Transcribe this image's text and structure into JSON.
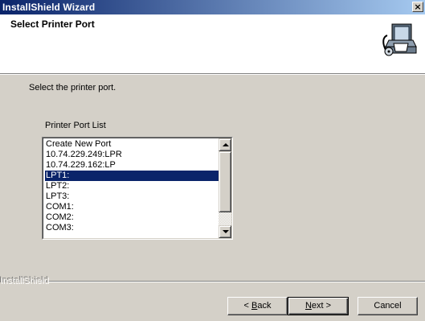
{
  "window": {
    "title": "InstallShield Wizard",
    "close_glyph": "×"
  },
  "header": {
    "title": "Select Printer Port",
    "icon": "printer-setup-icon"
  },
  "main": {
    "instruction": "Select the printer port.",
    "list_label": "Printer Port List",
    "ports": [
      "Create New Port",
      "10.74.229.249:LPR",
      "10.74.229.162:LP",
      "LPT1:",
      "LPT2:",
      "LPT3:",
      "COM1:",
      "COM2:",
      "COM3:"
    ],
    "selected_port": "LPT1:"
  },
  "footer": {
    "brand": "InstallShield",
    "back": {
      "mnemonic": "B",
      "rest": "ack",
      "prefix": "< "
    },
    "next": {
      "mnemonic": "N",
      "rest": "ext",
      "suffix": " >"
    },
    "cancel": "Cancel"
  },
  "colors": {
    "title_gradient_start": "#0a246a",
    "title_gradient_end": "#a6caf0",
    "selection": "#0a246a",
    "face": "#d4d0c8"
  }
}
